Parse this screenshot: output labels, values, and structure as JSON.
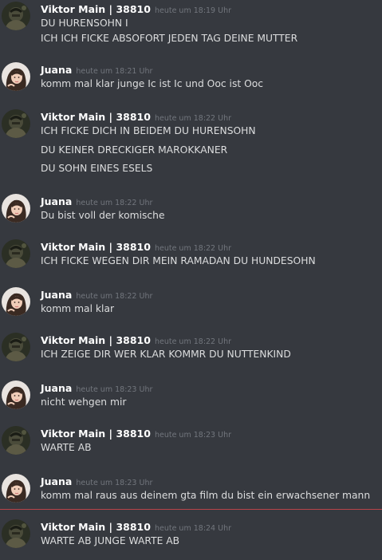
{
  "users": {
    "viktor": {
      "name": "Viktor Main | 38810",
      "avatar_icon": "dark-portrait-avatar-icon"
    },
    "juana": {
      "name": "Juana",
      "avatar_icon": "girl-portrait-avatar-icon"
    }
  },
  "messages": [
    {
      "author": "Viktor Main | 38810",
      "timestamp": "heute um 18:19 Uhr",
      "lines": [
        "DU HURENSOHN  I",
        "ICH ICH FICKE ABSOFORT JEDEN TAG DEINE MUTTER"
      ]
    },
    {
      "author": "Juana",
      "timestamp": "heute um 18:21 Uhr",
      "lines": [
        "komm mal klar junge Ic ist Ic und Ooc ist Ooc"
      ]
    },
    {
      "author": "Viktor Main | 38810",
      "timestamp": "heute um 18:22 Uhr",
      "lines": [
        "ICH FICKE DICH IN BEIDEM DU HURENSOHN",
        "DU KEINER DRECKIGER MAROKKANER",
        "DU SOHN EINES ESELS"
      ]
    },
    {
      "author": "Juana",
      "timestamp": "heute um 18:22 Uhr",
      "lines": [
        "Du bist voll der komische"
      ]
    },
    {
      "author": "Viktor Main | 38810",
      "timestamp": "heute um 18:22 Uhr",
      "lines": [
        "ICH FICKE WEGEN DIR MEIN RAMADAN DU HUNDESOHN"
      ]
    },
    {
      "author": "Juana",
      "timestamp": "heute um 18:22 Uhr",
      "lines": [
        "komm mal klar"
      ]
    },
    {
      "author": "Viktor Main | 38810",
      "timestamp": "heute um 18:22 Uhr",
      "lines": [
        "ICH ZEIGE DIR WER KLAR KOMMR DU NUTTENKIND"
      ]
    },
    {
      "author": "Juana",
      "timestamp": "heute um 18:23 Uhr",
      "lines": [
        "nicht wehgen mir"
      ]
    },
    {
      "author": "Viktor Main | 38810",
      "timestamp": "heute um 18:23 Uhr",
      "lines": [
        "WARTE AB"
      ]
    },
    {
      "author": "Juana",
      "timestamp": "heute um 18:23 Uhr",
      "lines": [
        "komm mal raus aus deinem gta film du bist ein erwachsener mann"
      ]
    },
    {
      "author": "Viktor Main | 38810",
      "timestamp": "heute um 18:24 Uhr",
      "lines": [
        "WARTE AB JUNGE WARTE AB"
      ]
    }
  ],
  "colors": {
    "background": "#36393f",
    "author": "#ffffff",
    "timestamp": "#72767d",
    "text": "#dcddde",
    "new_divider": "#d9474e"
  }
}
